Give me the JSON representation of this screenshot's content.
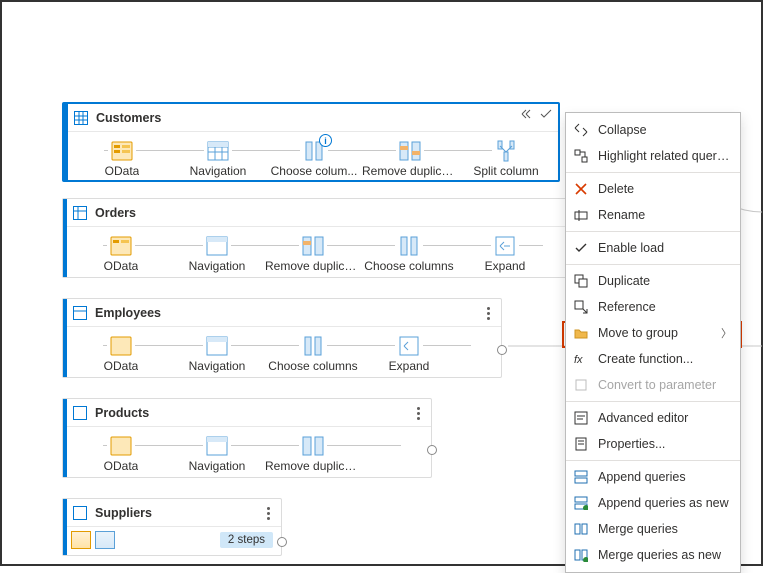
{
  "queries": {
    "customers": {
      "title": "Customers",
      "steps": [
        "OData",
        "Navigation",
        "Choose colum...",
        "Remove duplicat...",
        "Split column"
      ]
    },
    "orders": {
      "title": "Orders",
      "steps": [
        "OData",
        "Navigation",
        "Remove duplicat...",
        "Choose columns",
        "Expand"
      ]
    },
    "employees": {
      "title": "Employees",
      "steps": [
        "OData",
        "Navigation",
        "Choose columns",
        "Expand"
      ]
    },
    "products": {
      "title": "Products",
      "steps": [
        "OData",
        "Navigation",
        "Remove duplicat..."
      ]
    },
    "suppliers": {
      "title": "Suppliers",
      "steps_pill": "2 steps"
    }
  },
  "menu": {
    "collapse": "Collapse",
    "highlight": "Highlight related queries",
    "delete": "Delete",
    "rename": "Rename",
    "enable_load": "Enable load",
    "duplicate": "Duplicate",
    "reference": "Reference",
    "move_to_group": "Move to group",
    "create_function": "Create function...",
    "convert_param": "Convert to parameter",
    "advanced_editor": "Advanced editor",
    "properties": "Properties...",
    "append": "Append queries",
    "append_new": "Append queries as new",
    "merge": "Merge queries",
    "merge_new": "Merge queries as new"
  }
}
